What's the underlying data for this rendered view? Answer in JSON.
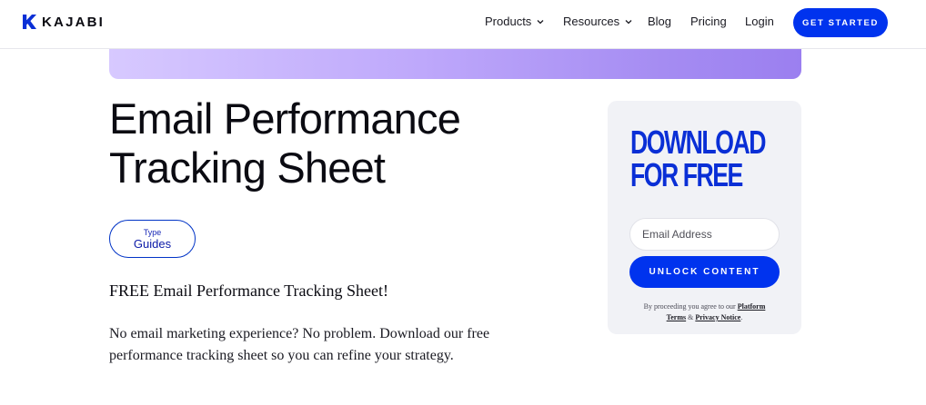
{
  "header": {
    "logo_text": "KAJABI",
    "nav": {
      "products": "Products",
      "resources": "Resources",
      "blog": "Blog",
      "pricing": "Pricing",
      "login": "Login"
    },
    "cta_label": "GET STARTED"
  },
  "main": {
    "title_line1": "Email Performance",
    "title_line2": "Tracking Sheet",
    "type_label": "Type",
    "type_value": "Guides",
    "lead": "FREE Email Performance Tracking Sheet!",
    "description": "No email marketing experience? No problem. Download our free performance tracking sheet so you can refine your strategy."
  },
  "download_card": {
    "title_line1": "DOWNLOAD",
    "title_line2": "FOR FREE",
    "email_placeholder": "Email Address",
    "email_value": "",
    "button_label": "UNLOCK CONTENT",
    "legal_prefix": "By proceeding you agree to our",
    "legal_link_platform": "Platform",
    "legal_link_terms": "Terms",
    "legal_amp": "&",
    "legal_link_privacy": "Privacy Notice",
    "legal_suffix": "."
  },
  "icons": {
    "logo": "kajabi-logo-icon",
    "dropdown": "chevron-down-icon"
  },
  "colors": {
    "brand_blue": "#0033ee",
    "card_bg": "#f1f2f6",
    "banner_start": "#d7c9ff",
    "banner_end": "#9b7ff0"
  }
}
